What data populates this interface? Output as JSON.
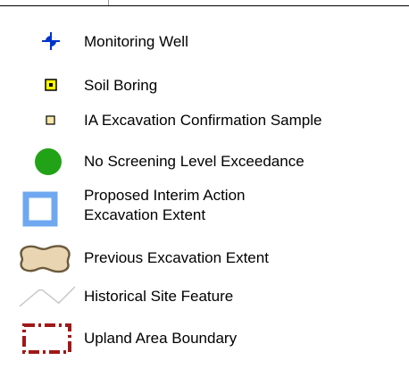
{
  "legend": {
    "items": [
      {
        "id": "monitoring-well",
        "label": "Monitoring Well",
        "icon": "monitoring-well-icon",
        "color": "#0033cc"
      },
      {
        "id": "soil-boring",
        "label": "Soil Boring",
        "icon": "soil-boring-icon",
        "color": "#ffff00"
      },
      {
        "id": "ia-confirmation-sample",
        "label": "IA Excavation Confirmation Sample",
        "icon": "confirmation-sample-icon",
        "color": "#f7e7a8"
      },
      {
        "id": "no-exceedance",
        "label": "No Screening Level Exceedance",
        "icon": "green-circle-icon",
        "color": "#22a317"
      },
      {
        "id": "proposed-excavation",
        "label_line1": "Proposed Interim Action",
        "label_line2": "Excavation Extent",
        "icon": "proposed-excavation-icon",
        "color": "#6fa8f0"
      },
      {
        "id": "previous-excavation",
        "label": "Previous Excavation Extent",
        "icon": "previous-excavation-icon",
        "color": "#e9d5b2"
      },
      {
        "id": "historical-feature",
        "label": "Historical Site Feature",
        "icon": "historical-feature-icon",
        "color": "#c8c8c8"
      },
      {
        "id": "upland-boundary",
        "label": "Upland Area Boundary",
        "icon": "upland-boundary-icon",
        "color": "#a01818"
      }
    ]
  }
}
